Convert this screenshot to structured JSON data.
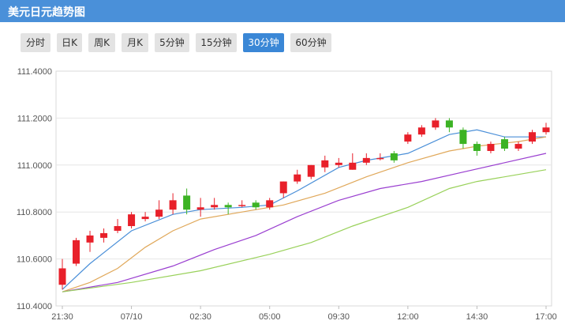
{
  "header": {
    "title": "美元日元趋势图"
  },
  "tabs": [
    {
      "label": "分时",
      "active": false
    },
    {
      "label": "日K",
      "active": false
    },
    {
      "label": "周K",
      "active": false
    },
    {
      "label": "月K",
      "active": false
    },
    {
      "label": "5分钟",
      "active": false
    },
    {
      "label": "15分钟",
      "active": false
    },
    {
      "label": "30分钟",
      "active": true
    },
    {
      "label": "60分钟",
      "active": false
    }
  ],
  "colors": {
    "up": "#e8202a",
    "down": "#3cb324",
    "ma1": "#4a8fd8",
    "ma2": "#e0a85a",
    "ma3": "#9a3fd0",
    "ma4": "#99d15a",
    "accent": "#3a87d6"
  },
  "chart_data": {
    "type": "candlestick",
    "ylim": [
      110.4,
      111.4
    ],
    "yticks": [
      "110.4000",
      "110.6000",
      "110.8000",
      "111.0000",
      "111.2000",
      "111.4000"
    ],
    "xticks": [
      {
        "label": "21:30",
        "index": 0
      },
      {
        "label": "07/10",
        "index": 5
      },
      {
        "label": "02:30",
        "index": 10
      },
      {
        "label": "05:00",
        "index": 15
      },
      {
        "label": "09:30",
        "index": 20
      },
      {
        "label": "12:00",
        "index": 25
      },
      {
        "label": "14:30",
        "index": 30
      },
      {
        "label": "17:00",
        "index": 35
      }
    ],
    "candles": [
      {
        "o": 110.49,
        "c": 110.56,
        "h": 110.6,
        "l": 110.47
      },
      {
        "o": 110.58,
        "c": 110.68,
        "h": 110.69,
        "l": 110.57
      },
      {
        "o": 110.67,
        "c": 110.7,
        "h": 110.72,
        "l": 110.63
      },
      {
        "o": 110.69,
        "c": 110.71,
        "h": 110.73,
        "l": 110.67
      },
      {
        "o": 110.72,
        "c": 110.74,
        "h": 110.77,
        "l": 110.71
      },
      {
        "o": 110.74,
        "c": 110.79,
        "h": 110.8,
        "l": 110.73
      },
      {
        "o": 110.77,
        "c": 110.78,
        "h": 110.8,
        "l": 110.76
      },
      {
        "o": 110.78,
        "c": 110.81,
        "h": 110.85,
        "l": 110.77
      },
      {
        "o": 110.81,
        "c": 110.85,
        "h": 110.88,
        "l": 110.79
      },
      {
        "o": 110.87,
        "c": 110.81,
        "h": 110.9,
        "l": 110.79
      },
      {
        "o": 110.81,
        "c": 110.82,
        "h": 110.86,
        "l": 110.78
      },
      {
        "o": 110.82,
        "c": 110.83,
        "h": 110.86,
        "l": 110.81
      },
      {
        "o": 110.83,
        "c": 110.82,
        "h": 110.84,
        "l": 110.79
      },
      {
        "o": 110.83,
        "c": 110.83,
        "h": 110.85,
        "l": 110.82
      },
      {
        "o": 110.84,
        "c": 110.82,
        "h": 110.85,
        "l": 110.81
      },
      {
        "o": 110.82,
        "c": 110.85,
        "h": 110.86,
        "l": 110.81
      },
      {
        "o": 110.88,
        "c": 110.93,
        "h": 110.93,
        "l": 110.86
      },
      {
        "o": 110.93,
        "c": 110.96,
        "h": 110.98,
        "l": 110.92
      },
      {
        "o": 110.95,
        "c": 111.0,
        "h": 111.0,
        "l": 110.94
      },
      {
        "o": 110.99,
        "c": 111.02,
        "h": 111.04,
        "l": 110.97
      },
      {
        "o": 111.0,
        "c": 111.01,
        "h": 111.03,
        "l": 110.99
      },
      {
        "o": 110.98,
        "c": 111.01,
        "h": 111.05,
        "l": 110.98
      },
      {
        "o": 111.01,
        "c": 111.03,
        "h": 111.05,
        "l": 111.0
      },
      {
        "o": 111.03,
        "c": 111.03,
        "h": 111.05,
        "l": 111.02
      },
      {
        "o": 111.05,
        "c": 111.02,
        "h": 111.06,
        "l": 111.01
      },
      {
        "o": 111.1,
        "c": 111.13,
        "h": 111.14,
        "l": 111.09
      },
      {
        "o": 111.13,
        "c": 111.16,
        "h": 111.17,
        "l": 111.12
      },
      {
        "o": 111.16,
        "c": 111.19,
        "h": 111.2,
        "l": 111.15
      },
      {
        "o": 111.19,
        "c": 111.16,
        "h": 111.2,
        "l": 111.14
      },
      {
        "o": 111.15,
        "c": 111.09,
        "h": 111.16,
        "l": 111.07
      },
      {
        "o": 111.09,
        "c": 111.06,
        "h": 111.1,
        "l": 111.04
      },
      {
        "o": 111.06,
        "c": 111.09,
        "h": 111.1,
        "l": 111.05
      },
      {
        "o": 111.11,
        "c": 111.07,
        "h": 111.12,
        "l": 111.06
      },
      {
        "o": 111.07,
        "c": 111.09,
        "h": 111.1,
        "l": 111.06
      },
      {
        "o": 111.1,
        "c": 111.14,
        "h": 111.15,
        "l": 111.09
      },
      {
        "o": 111.14,
        "c": 111.16,
        "h": 111.18,
        "l": 111.13
      }
    ],
    "series": [
      {
        "color": "#4a8fd8",
        "points": [
          [
            0,
            110.47
          ],
          [
            2,
            110.58
          ],
          [
            5,
            110.72
          ],
          [
            8,
            110.79
          ],
          [
            10,
            110.81
          ],
          [
            13,
            110.82
          ],
          [
            15,
            110.83
          ],
          [
            17,
            110.89
          ],
          [
            20,
            110.99
          ],
          [
            22,
            111.02
          ],
          [
            25,
            111.05
          ],
          [
            28,
            111.13
          ],
          [
            30,
            111.15
          ],
          [
            32,
            111.12
          ],
          [
            35,
            111.12
          ]
        ]
      },
      {
        "color": "#e0a85a",
        "points": [
          [
            0,
            110.46
          ],
          [
            2,
            110.5
          ],
          [
            4,
            110.56
          ],
          [
            6,
            110.65
          ],
          [
            8,
            110.72
          ],
          [
            10,
            110.77
          ],
          [
            13,
            110.8
          ],
          [
            16,
            110.83
          ],
          [
            19,
            110.88
          ],
          [
            22,
            110.95
          ],
          [
            25,
            111.01
          ],
          [
            28,
            111.06
          ],
          [
            30,
            111.08
          ],
          [
            33,
            111.1
          ],
          [
            35,
            111.12
          ]
        ]
      },
      {
        "color": "#9a3fd0",
        "points": [
          [
            0,
            110.46
          ],
          [
            4,
            110.5
          ],
          [
            8,
            110.57
          ],
          [
            11,
            110.64
          ],
          [
            14,
            110.7
          ],
          [
            17,
            110.78
          ],
          [
            20,
            110.85
          ],
          [
            23,
            110.9
          ],
          [
            26,
            110.93
          ],
          [
            29,
            110.97
          ],
          [
            32,
            111.01
          ],
          [
            35,
            111.05
          ]
        ]
      },
      {
        "color": "#99d15a",
        "points": [
          [
            0,
            110.46
          ],
          [
            5,
            110.5
          ],
          [
            10,
            110.55
          ],
          [
            15,
            110.62
          ],
          [
            18,
            110.67
          ],
          [
            21,
            110.74
          ],
          [
            25,
            110.82
          ],
          [
            28,
            110.9
          ],
          [
            30,
            110.93
          ],
          [
            33,
            110.96
          ],
          [
            35,
            110.98
          ]
        ]
      }
    ]
  }
}
